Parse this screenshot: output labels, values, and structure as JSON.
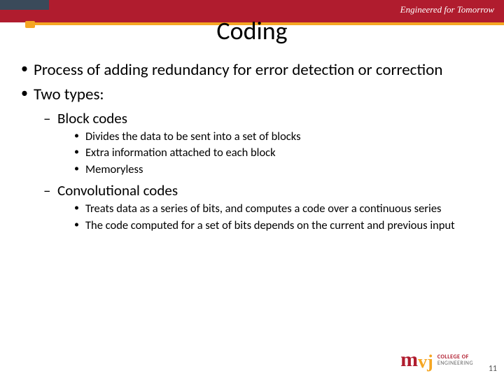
{
  "header": {
    "tagline": "Engineered for Tomorrow",
    "title": "Coding"
  },
  "bullets": {
    "b1": "Process of adding redundancy for error detection or correction",
    "b2": "Two types:",
    "b2a": "Block codes",
    "b2a1": "Divides the data to be sent into a set of blocks",
    "b2a2": "Extra information attached to each block",
    "b2a3": "Memoryless",
    "b2b": "Convolutional codes",
    "b2b1": "Treats data as a series of bits, and computes a code over a continuous series",
    "b2b2": "The code computed for a set of bits depends on the current and previous input"
  },
  "logo": {
    "m": "m",
    "vj": "vj",
    "line1": "COLLEGE OF",
    "line2": "ENGINEERING",
    "line3": ""
  },
  "pagenum": "11"
}
